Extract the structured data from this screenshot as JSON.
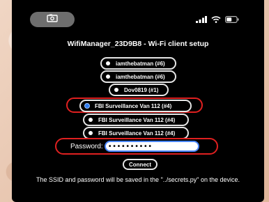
{
  "status_bar": {
    "camera_icon": "camera-icon",
    "signal_icon": "cellular-signal-icon",
    "wifi_icon": "wifi-icon",
    "battery_icon": "battery-icon"
  },
  "page": {
    "title": "WifiManager_23D9B8 - Wi-Fi client setup"
  },
  "networks": [
    {
      "label": "iamthebatman (#6)",
      "selected": false
    },
    {
      "label": "iamthebatman (#6)",
      "selected": false
    },
    {
      "label": "Dov0819 (#1)",
      "selected": false
    },
    {
      "label": "FBI Surveillance Van 112 (#4)",
      "selected": true
    },
    {
      "label": "FBI Surveillance Van 112 (#4)",
      "selected": false
    },
    {
      "label": "FBI Surveillance Van 112 (#4)",
      "selected": false
    }
  ],
  "password": {
    "label": "Password:",
    "value": "••••••••••"
  },
  "connect_label": "Connect",
  "footnote": "The SSID and password will be saved in the \"../secrets.py\" on the device.",
  "colors": {
    "highlight": "#e02020",
    "selected_radio": "#2f7df2",
    "input_border": "#4a86ff"
  }
}
